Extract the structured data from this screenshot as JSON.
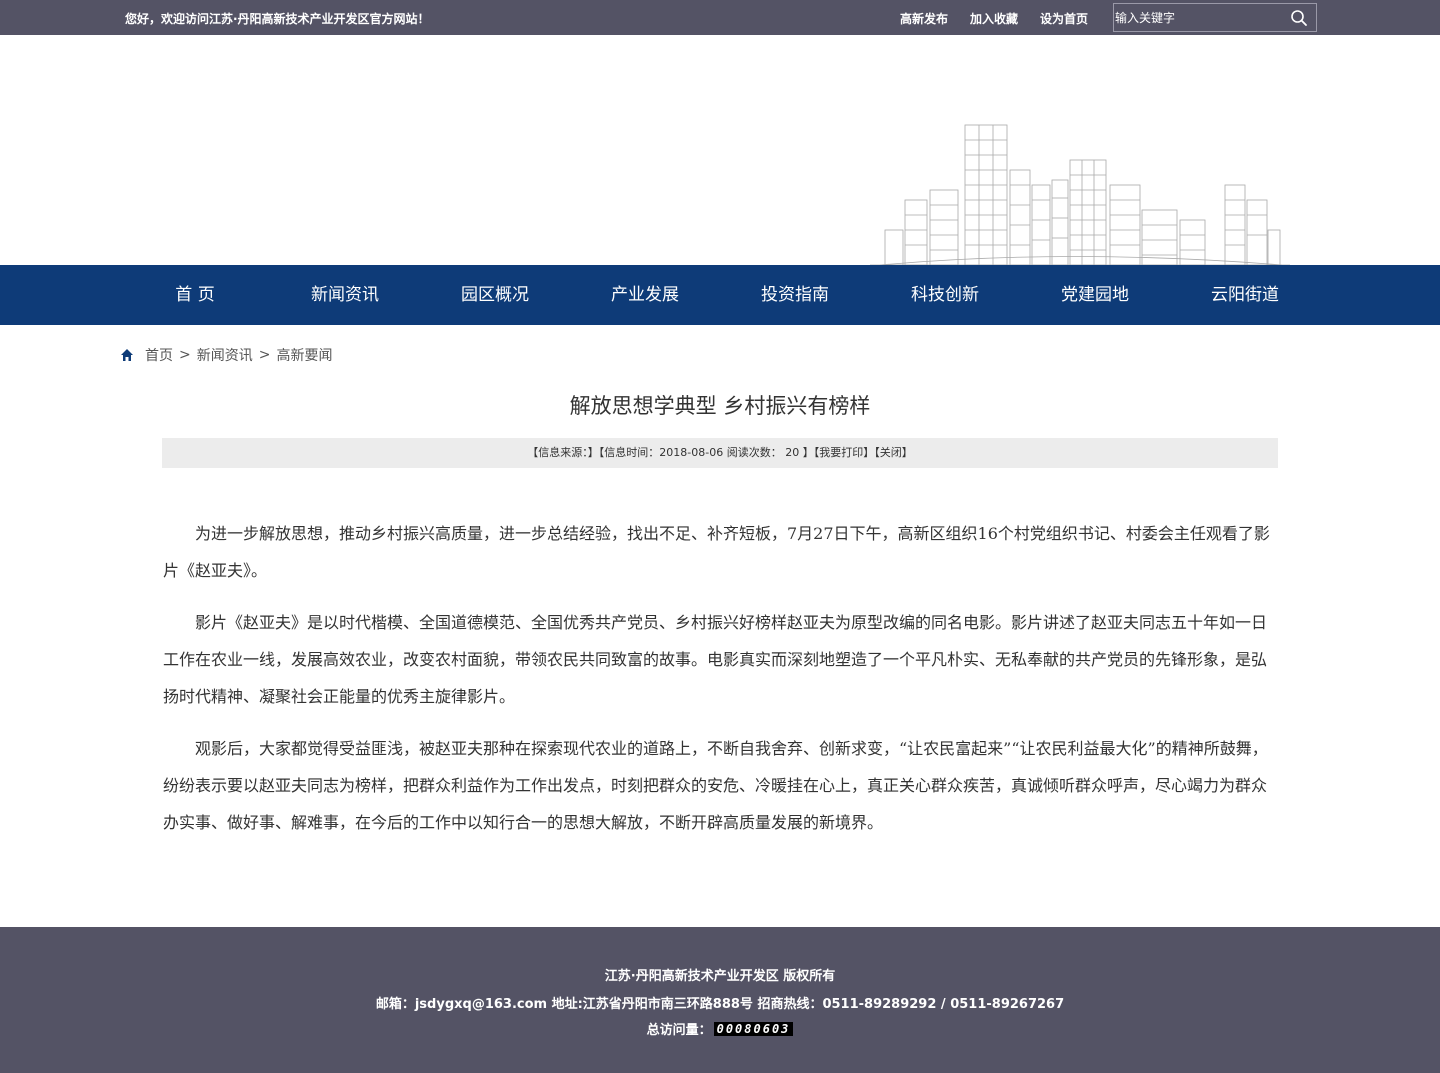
{
  "topbar": {
    "welcome": "您好，欢迎访问江苏·丹阳高新技术产业开发区官方网站！",
    "links": [
      "高新发布",
      "加入收藏",
      "设为首页"
    ],
    "search_placeholder": "输入关键字",
    "search_icon": "magnifier-icon"
  },
  "nav": {
    "items": [
      "首 页",
      "新闻资讯",
      "园区概况",
      "产业发展",
      "投资指南",
      "科技创新",
      "党建园地",
      "云阳街道"
    ]
  },
  "breadcrumb": {
    "icon": "home-icon",
    "items": [
      "首页",
      "新闻资讯",
      "高新要闻"
    ],
    "separator": ">"
  },
  "article": {
    "title": "解放思想学典型 乡村振兴有榜样",
    "meta": {
      "source_label": "【信息来源：】",
      "time_label": "【信息时间：2018-08-06  阅读次数：  20  】",
      "print_label": "【我要打印】",
      "close_label": "【关闭】"
    },
    "paragraphs": [
      "为进一步解放思想，推动乡村振兴高质量，进一步总结经验，找出不足、补齐短板，7月27日下午，高新区组织16个村党组织书记、村委会主任观看了影片《赵亚夫》。",
      "影片《赵亚夫》是以时代楷模、全国道德模范、全国优秀共产党员、乡村振兴好榜样赵亚夫为原型改编的同名电影。影片讲述了赵亚夫同志五十年如一日工作在农业一线，发展高效农业，改变农村面貌，带领农民共同致富的故事。电影真实而深刻地塑造了一个平凡朴实、无私奉献的共产党员的先锋形象，是弘扬时代精神、凝聚社会正能量的优秀主旋律影片。",
      "观影后，大家都觉得受益匪浅，被赵亚夫那种在探索现代农业的道路上，不断自我舍弃、创新求变，“让农民富起来”“让农民利益最大化”的精神所鼓舞，纷纷表示要以赵亚夫同志为榜样，把群众利益作为工作出发点，时刻把群众的安危、冷暖挂在心上，真正关心群众疾苦，真诚倾听群众呼声，尽心竭力为群众办实事、做好事、解难事，在今后的工作中以知行合一的思想大解放，不断开辟高质量发展的新境界。"
    ]
  },
  "footer": {
    "copyright": "江苏·丹阳高新技术产业开发区 版权所有",
    "contact": "邮箱：jsdygxq@163.com 地址:江苏省丹阳市南三环路888号 招商热线：0511-89289292 / 0511-89267267",
    "visits_label": "总访问量：",
    "visits_count": "00080603"
  },
  "colors": {
    "topbar_bg": "#545365",
    "nav_bg": "#0e3b78",
    "meta_bg": "#ececec",
    "footer_bg": "#545365"
  }
}
